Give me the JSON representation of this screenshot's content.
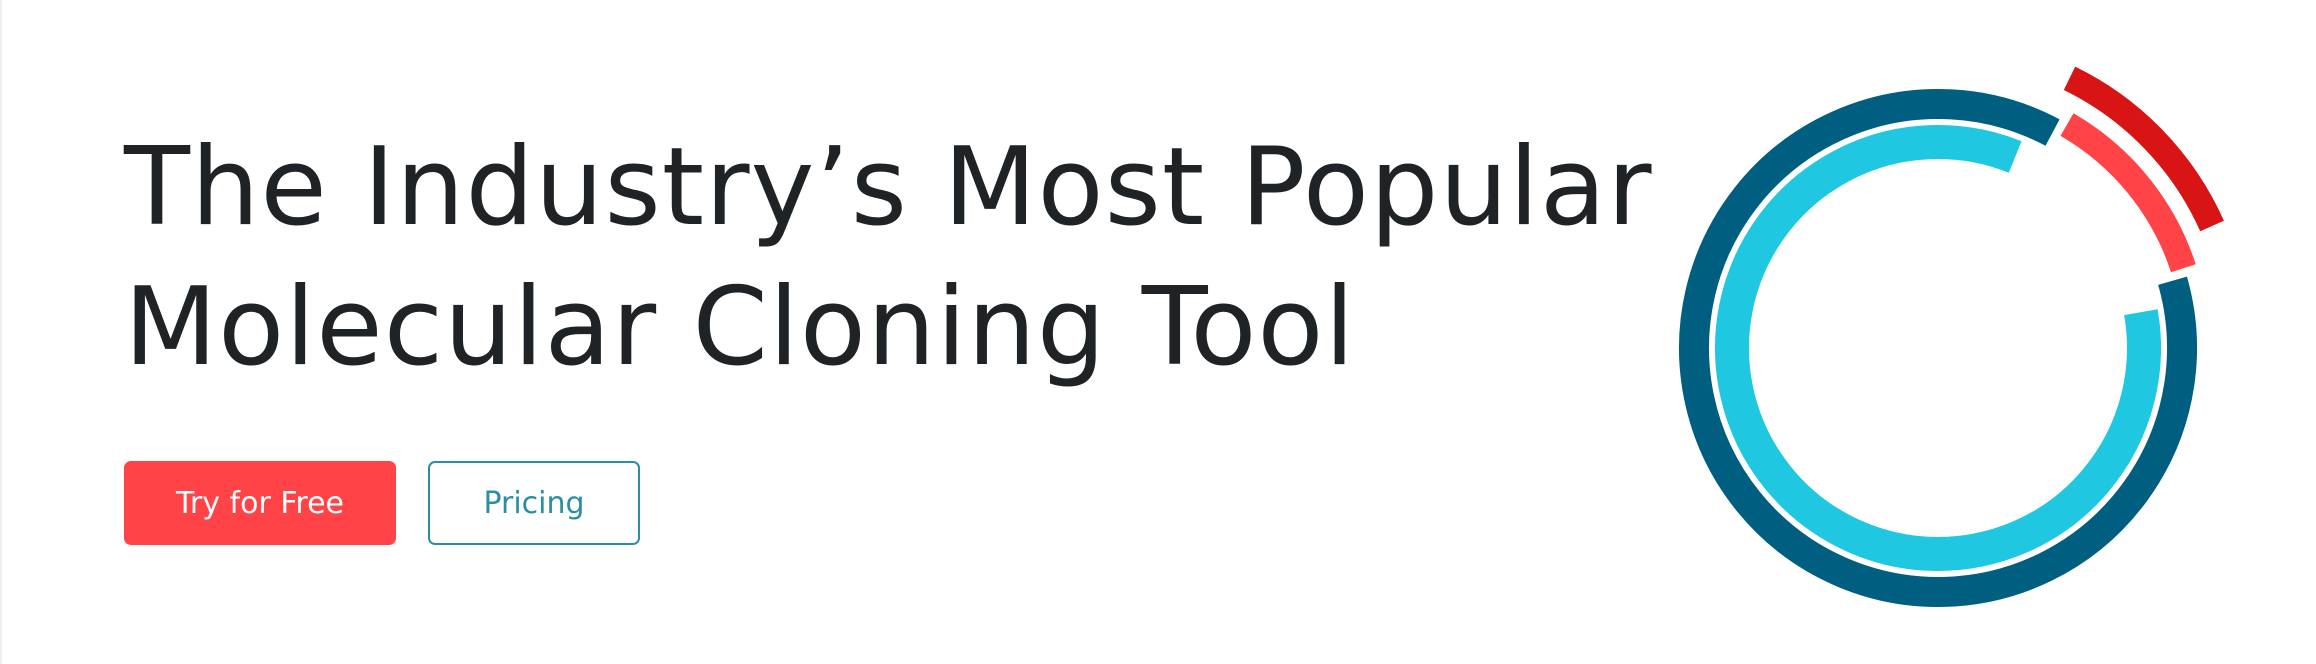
{
  "hero": {
    "headline_line1": "The Industry’s Most Popular",
    "headline_line2": "Molecular Cloning Tool",
    "primary_button": "Try for Free",
    "secondary_button": "Pricing"
  },
  "logo": {
    "icon": "plasmid-ring-logo"
  },
  "colors": {
    "primary_red": "#ff4347",
    "dark_red": "#d81414",
    "teal_dark": "#005f80",
    "teal_light": "#1fc7e0",
    "button_outline": "#2a8fa3",
    "text": "#1f2326"
  }
}
